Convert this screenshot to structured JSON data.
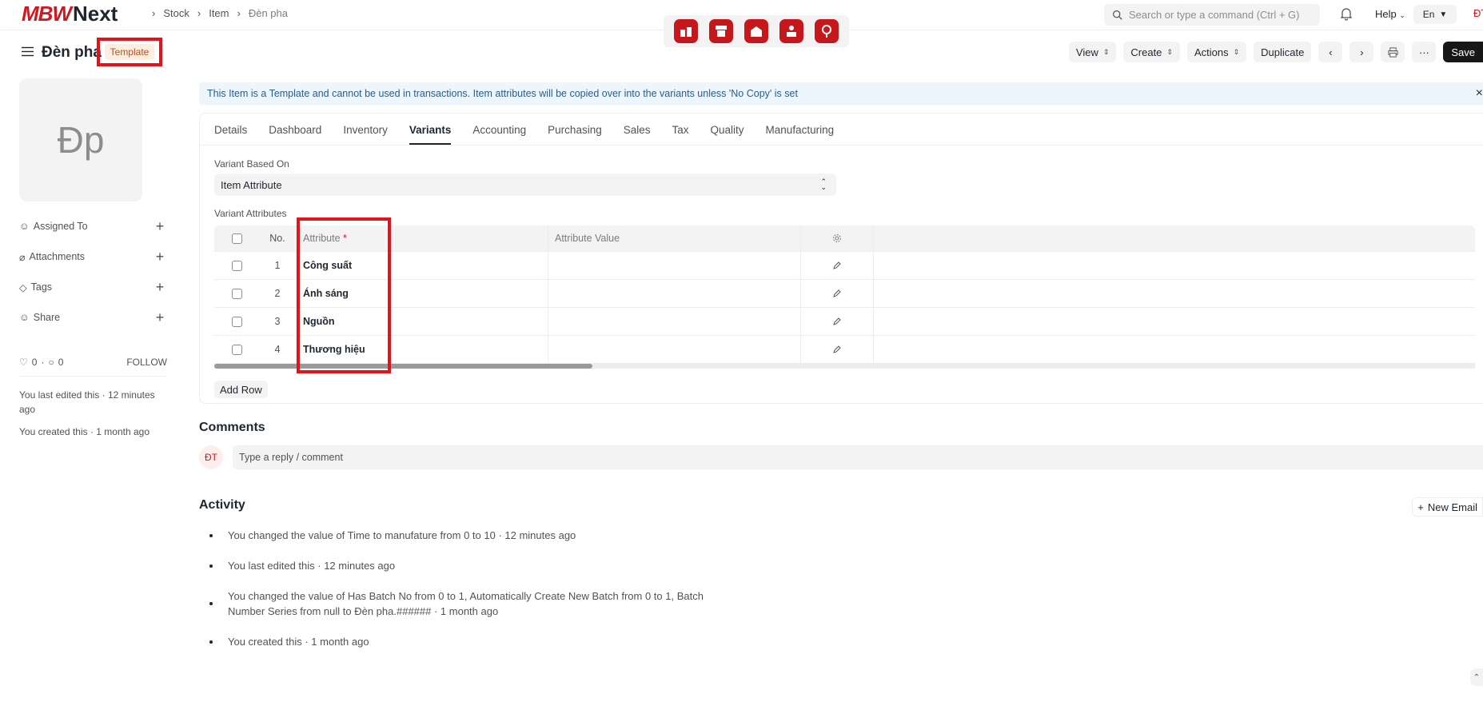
{
  "brand": {
    "mark": "MBW",
    "name": "Next"
  },
  "breadcrumbs": [
    "Stock",
    "Item",
    "Đèn pha"
  ],
  "search": {
    "placeholder": "Search or type a command (Ctrl + G)"
  },
  "top_right": {
    "help": "Help",
    "lang": "En",
    "user_initials": "ĐT"
  },
  "app_icons": [
    "stock-app-icon",
    "pos-app-icon",
    "warehouse-app-icon",
    "hr-app-icon",
    "location-app-icon"
  ],
  "page": {
    "title": "Đèn pha",
    "badge": "Template",
    "actions": {
      "view": "View",
      "create": "Create",
      "actions": "Actions",
      "duplicate": "Duplicate",
      "save": "Save"
    }
  },
  "sidebar": {
    "image_initials": "Đp",
    "items": [
      {
        "label": "Assigned To",
        "icon": "user-icon"
      },
      {
        "label": "Attachments",
        "icon": "paperclip-icon"
      },
      {
        "label": "Tags",
        "icon": "tag-icon"
      },
      {
        "label": "Share",
        "icon": "share-icon"
      }
    ],
    "likes": "0",
    "comments": "0",
    "follow": "FOLLOW",
    "last_edited": "You last edited this · 12 minutes ago",
    "created": "You created this · 1 month ago"
  },
  "banner": {
    "text": "This Item is a Template and cannot be used in transactions. Item attributes will be copied over into the variants unless 'No Copy' is set",
    "close": "×"
  },
  "tabs": [
    "Details",
    "Dashboard",
    "Inventory",
    "Variants",
    "Accounting",
    "Purchasing",
    "Sales",
    "Tax",
    "Quality",
    "Manufacturing"
  ],
  "active_tab": "Variants",
  "variants": {
    "based_on_label": "Variant Based On",
    "based_on_value": "Item Attribute",
    "attributes_label": "Variant Attributes",
    "columns": {
      "no": "No.",
      "attribute": "Attribute",
      "required": "*",
      "value": "Attribute Value"
    },
    "rows": [
      {
        "no": "1",
        "attribute": "Công suất",
        "value": ""
      },
      {
        "no": "2",
        "attribute": "Ánh sáng",
        "value": ""
      },
      {
        "no": "3",
        "attribute": "Nguồn",
        "value": ""
      },
      {
        "no": "4",
        "attribute": "Thương hiệu",
        "value": ""
      }
    ],
    "add_row": "Add Row"
  },
  "comments": {
    "title": "Comments",
    "avatar": "ĐT",
    "placeholder": "Type a reply / comment"
  },
  "activity": {
    "title": "Activity",
    "new_email": "New Email",
    "items": [
      "You changed the value of Time to manufature from 0 to 10 · 12 minutes ago",
      "You last edited this · 12 minutes ago",
      "You changed the value of Has Batch No from 0 to 1, Automatically Create New Batch from 0 to 1, Batch Number Series from null to Đèn pha.###### · 1 month ago",
      "You created this · 1 month ago"
    ]
  },
  "colors": {
    "brand_red": "#d0181e",
    "highlight": "#e0141a",
    "banner_bg": "#edf6fd"
  }
}
